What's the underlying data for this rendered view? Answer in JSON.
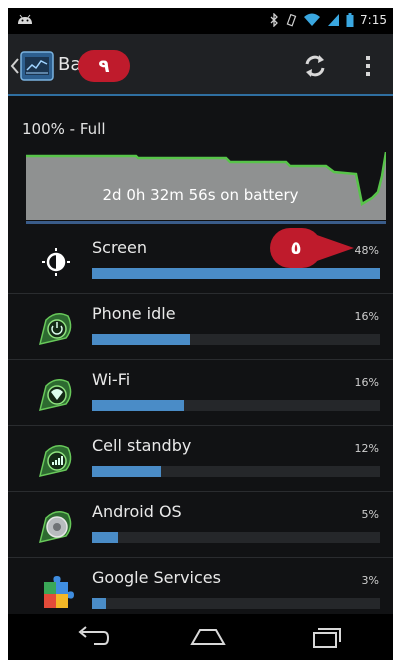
{
  "status_bar": {
    "time": "7:15",
    "icons": [
      "android-debug-icon",
      "bluetooth-icon",
      "vibrate-icon",
      "wifi-icon",
      "signal-icon",
      "battery-icon"
    ]
  },
  "action_bar": {
    "title": "Ba",
    "icons": [
      "back-caret-icon",
      "battery-app-icon",
      "refresh-icon",
      "overflow-menu-icon"
    ]
  },
  "callouts": {
    "top": "٩",
    "screen": "٥"
  },
  "battery": {
    "level_text": "100% - Full",
    "duration_text": "2d 0h 32m 56s on battery",
    "colors": {
      "graph_fill": "#8f9191",
      "graph_line": "#58c44a",
      "graph_base": "#3a5c8a"
    }
  },
  "usage_items": [
    {
      "label": "Screen",
      "percent": "48%",
      "fill": 1.0,
      "icon": "brightness-icon"
    },
    {
      "label": "Phone idle",
      "percent": "16%",
      "fill": 0.34,
      "icon": "power-idle-icon"
    },
    {
      "label": "Wi-Fi",
      "percent": "16%",
      "fill": 0.32,
      "icon": "wifi-icon"
    },
    {
      "label": "Cell standby",
      "percent": "12%",
      "fill": 0.24,
      "icon": "cell-signal-icon"
    },
    {
      "label": "Android OS",
      "percent": "5%",
      "fill": 0.09,
      "icon": "android-os-icon"
    },
    {
      "label": "Google Services",
      "percent": "3%",
      "fill": 0.05,
      "icon": "puzzle-piece-icon"
    }
  ],
  "navigation": {
    "buttons": [
      "back-nav-icon",
      "home-nav-icon",
      "recents-nav-icon"
    ]
  },
  "accent": "#4a8cc7",
  "callout_color": "#bf1b2c"
}
